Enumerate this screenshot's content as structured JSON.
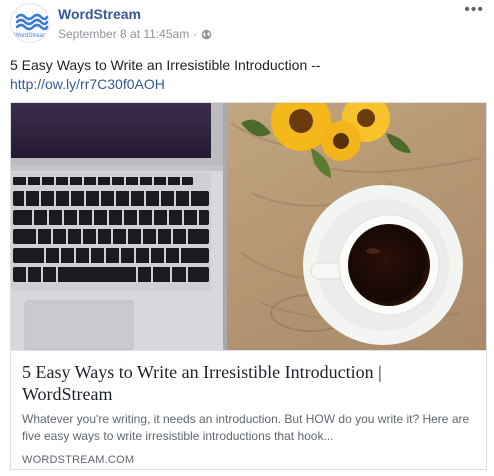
{
  "post": {
    "author": "WordStream",
    "timestamp": "September 8 at 11:45am",
    "separator": "·",
    "avatar_text": "WordStream",
    "more_label": "•••",
    "text": "5 Easy Ways to Write an Irresistible Introduction --",
    "link": "http://ow.ly/rr7C30f0AOH"
  },
  "card": {
    "title": "5 Easy Ways to Write an Irresistible Introduction | WordStream",
    "description": "Whatever you're writing, it needs an introduction. But HOW do you write it? Here are five easy ways to write irresistible introductions that hook...",
    "domain": "WORDSTREAM.COM"
  },
  "colors": {
    "author": "#365899",
    "link": "#365899",
    "meta": "#90949c",
    "logo_blue": "#3a7bd5"
  }
}
